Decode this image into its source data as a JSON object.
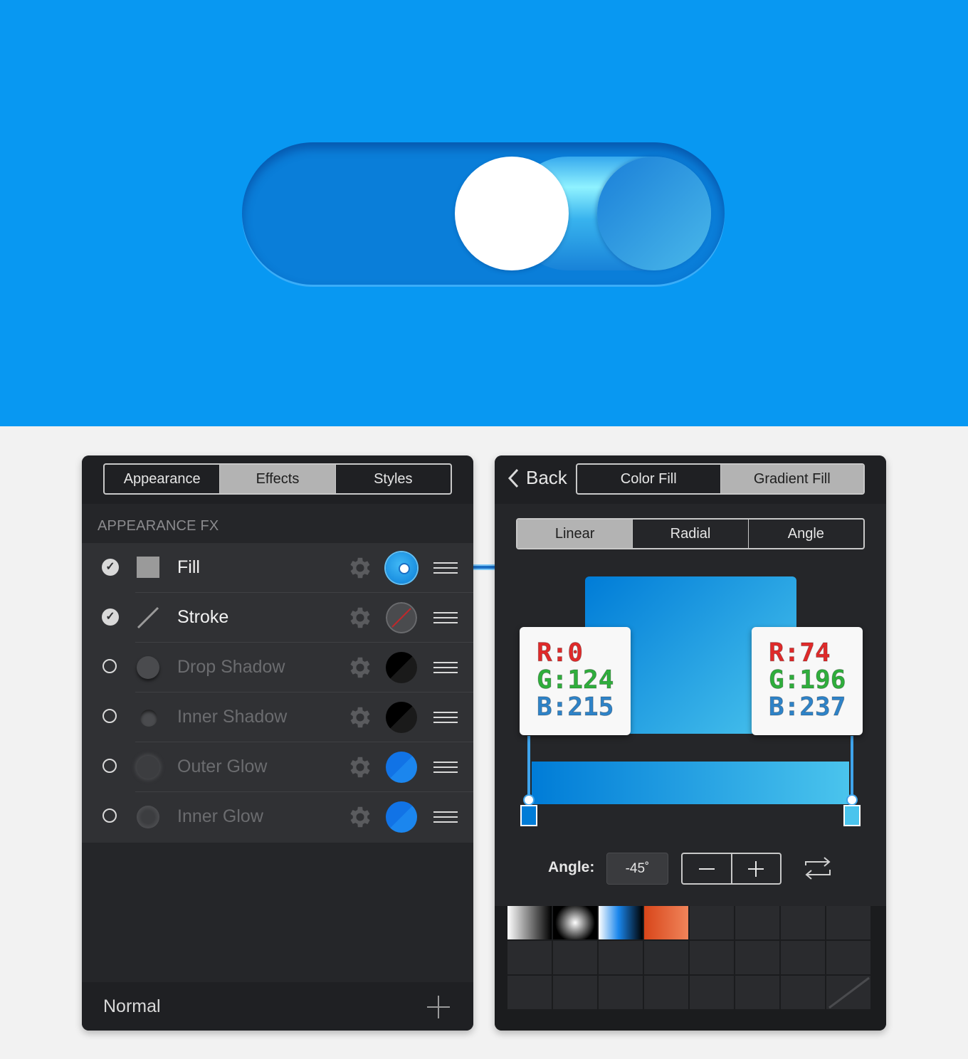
{
  "colors": {
    "background_blue": "#0898f2",
    "track_blue": "#0a7ed9",
    "gradient_start": "#007cd7",
    "gradient_end": "#4ac4ed",
    "panel_bg": "#252629"
  },
  "toggle": {
    "state": "on"
  },
  "left_panel": {
    "tabs": [
      {
        "label": "Appearance",
        "selected": false
      },
      {
        "label": "Effects",
        "selected": true
      },
      {
        "label": "Styles",
        "selected": false
      }
    ],
    "section_title": "APPEARANCE FX",
    "items": [
      {
        "label": "Fill",
        "enabled": true,
        "icon": "square-icon",
        "swatch": "gradient-blue"
      },
      {
        "label": "Stroke",
        "enabled": true,
        "icon": "line-icon",
        "swatch": "none"
      },
      {
        "label": "Drop Shadow",
        "enabled": false,
        "icon": "drop-shadow-icon",
        "swatch": "black"
      },
      {
        "label": "Inner Shadow",
        "enabled": false,
        "icon": "inner-shadow-icon",
        "swatch": "black"
      },
      {
        "label": "Outer Glow",
        "enabled": false,
        "icon": "outer-glow-icon",
        "swatch": "blue"
      },
      {
        "label": "Inner Glow",
        "enabled": false,
        "icon": "inner-glow-icon",
        "swatch": "blue"
      }
    ],
    "footer": {
      "blend_mode": "Normal"
    }
  },
  "right_panel": {
    "back_label": "Back",
    "fill_tabs": [
      {
        "label": "Color Fill",
        "selected": false
      },
      {
        "label": "Gradient Fill",
        "selected": true
      }
    ],
    "type_tabs": [
      {
        "label": "Linear",
        "selected": true
      },
      {
        "label": "Radial",
        "selected": false
      },
      {
        "label": "Angle",
        "selected": false
      }
    ],
    "stops": [
      {
        "r": "R:0",
        "g": "G:124",
        "b": "B:215",
        "color": "#007cd7"
      },
      {
        "r": "R:74",
        "g": "G:196",
        "b": "B:237",
        "color": "#4ac4ed"
      }
    ],
    "angle_label": "Angle:",
    "angle_value": "-45˚",
    "presets": [
      "white-black-linear",
      "white-black-radial",
      "white-blue-linear",
      "orange-linear"
    ]
  }
}
